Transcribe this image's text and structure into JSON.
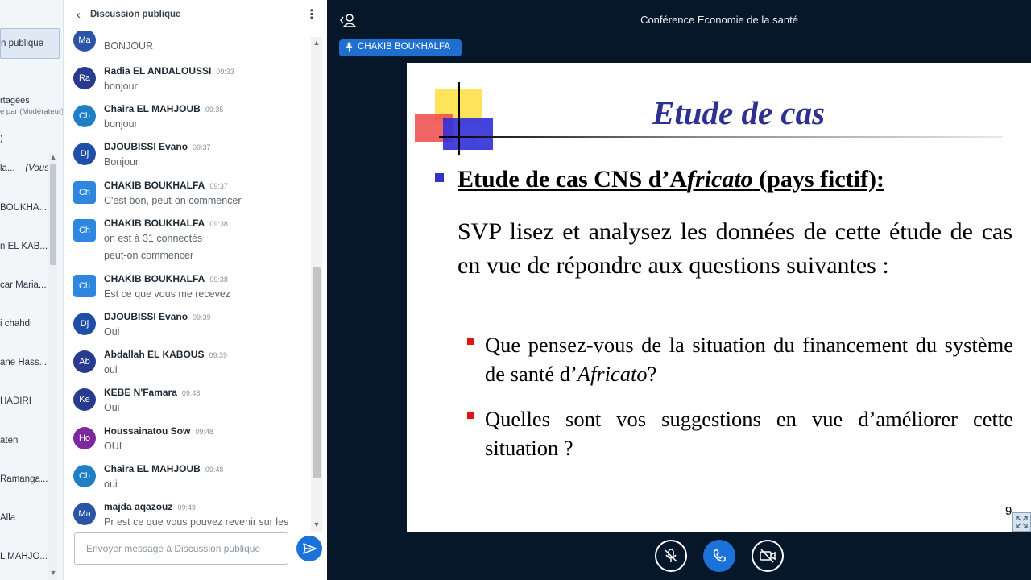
{
  "userlist": {
    "public_chat_label": "n publique",
    "shared_notes_label": "rtagées",
    "shared_notes_sub": "e par (Modérateur)",
    "count_label": ")",
    "you_label": "(Vous)",
    "users": [
      "la...",
      "BOUKHA...",
      "n EL KAB...",
      "car Maria...",
      "i chahdi",
      "ane Hass...",
      "HADIRI",
      "aten",
      "Ramanga...",
      "Alla",
      "L MAHJO..."
    ]
  },
  "chat": {
    "title": "Discussion publique",
    "input_placeholder": "Envoyer message à Discussion publique",
    "messages": [
      {
        "initials": "Ma",
        "name": "",
        "time": "",
        "text": "BONJOUR",
        "color": "#2a55a6"
      },
      {
        "initials": "Ra",
        "name": "Radia EL ANDALOUSSI",
        "time": "09:33",
        "text": "bonjour",
        "color": "#283b8f"
      },
      {
        "initials": "Ch",
        "name": "Chaira EL MAHJOUB",
        "time": "09:35",
        "text": "bonjour",
        "color": "#1f7fc4"
      },
      {
        "initials": "Dj",
        "name": "DJOUBISSI Evano",
        "time": "09:37",
        "text": "Bonjour",
        "color": "#1f4ea6"
      },
      {
        "initials": "Ch",
        "name": "CHAKIB BOUKHALFA",
        "time": "09:37",
        "text": "C'est bon, peut-on commencer",
        "color": "#2e86de"
      },
      {
        "initials": "Ch",
        "name": "CHAKIB BOUKHALFA",
        "time": "09:38",
        "text": "on est à 31 connectés",
        "text2": "peut-on commencer",
        "color": "#2e86de"
      },
      {
        "initials": "Ch",
        "name": "CHAKIB BOUKHALFA",
        "time": "09:38",
        "text": "Est ce que vous me recevez",
        "color": "#2e86de"
      },
      {
        "initials": "Dj",
        "name": "DJOUBISSI Evano",
        "time": "09:39",
        "text": "Oui",
        "color": "#1f4ea6"
      },
      {
        "initials": "Ab",
        "name": "Abdallah EL KABOUS",
        "time": "09:39",
        "text": "oui",
        "color": "#283b8f"
      },
      {
        "initials": "Ke",
        "name": "KEBE N'Famara",
        "time": "09:48",
        "text": "Oui",
        "color": "#283b8f"
      },
      {
        "initials": "Ho",
        "name": "Houssainatou Sow",
        "time": "09:48",
        "text": "OUI",
        "color": "#7b2a9e"
      },
      {
        "initials": "Ch",
        "name": "Chaira EL MAHJOUB",
        "time": "09:48",
        "text": "oui",
        "color": "#1f7fc4"
      },
      {
        "initials": "Ma",
        "name": "majda aqazouz",
        "time": "09:49",
        "text": "Pr est ce que vous pouvez revenir sur les",
        "color": "#2a55a6"
      }
    ]
  },
  "presentation": {
    "meeting_title": "Conférence Economie de la santé",
    "talker": "CHAKIB BOUKHALFA",
    "minimize_label": "–",
    "slide": {
      "title": "Etude de cas",
      "heading_pre": "Etude de cas CNS d’A",
      "heading_italic": "fricato",
      "heading_post": " (pays fictif):",
      "paragraph": "SVP lisez et analysez les données de cette étude de cas en vue de répondre aux questions suivantes :",
      "q1_pre": "Que pensez-vous de la situation du financement du système de santé d’",
      "q1_italic": "Africato",
      "q1_post": "?",
      "q2": "Quelles sont vos suggestions en vue d’améliorer cette situation ?",
      "page": "9"
    }
  },
  "colors": {
    "accent": "#1b73d9",
    "background": "#06172a",
    "slide_title": "#2e3192"
  }
}
